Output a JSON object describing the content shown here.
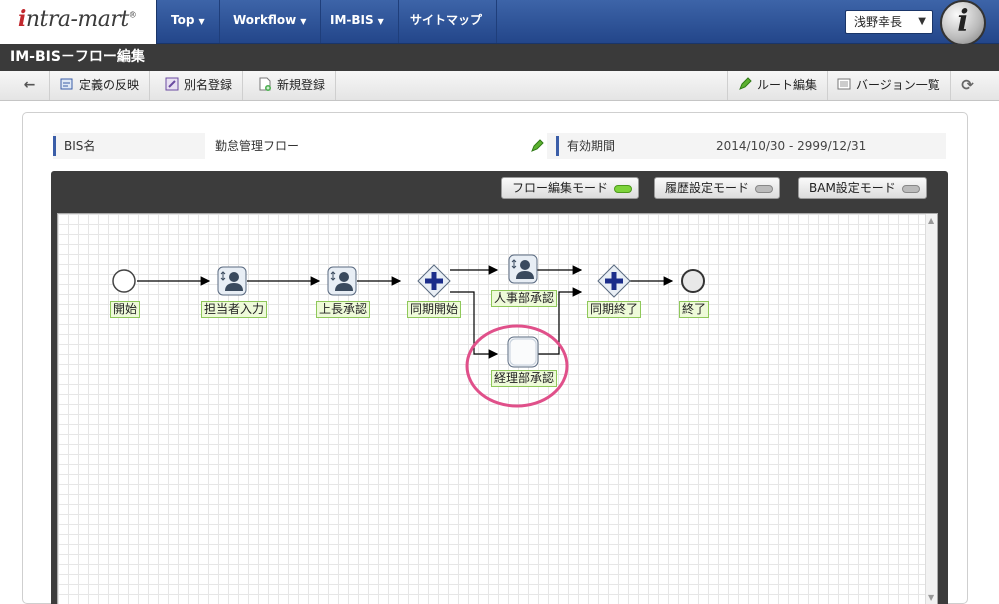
{
  "logo": {
    "text_i": "i",
    "text_rest": "ntra-mart",
    "reg": "®"
  },
  "nav": [
    {
      "label": "Top",
      "caret": "▼"
    },
    {
      "label": "Workflow",
      "caret": "▼"
    },
    {
      "label": "IM-BIS",
      "caret": "▼"
    },
    {
      "label": "サイトマップ",
      "caret": ""
    }
  ],
  "user": {
    "name": "浅野幸長",
    "caret": "▼",
    "avatar_letter": "i"
  },
  "page_title": "IM-BIS－フロー編集",
  "toolbar": {
    "back_icon": "←",
    "reflect": "定義の反映",
    "alias": "別名登録",
    "new": "新規登録",
    "route_edit": "ルート編集",
    "version_list": "バージョン一覧",
    "refresh_icon": "⟳"
  },
  "info": {
    "bis_name_label": "BIS名",
    "bis_name_value": "勤怠管理フロー",
    "period_label": "有効期間",
    "period_value": "2014/10/30 ‐ 2999/12/31"
  },
  "modes": [
    {
      "label": "フロー編集モード",
      "active": true
    },
    {
      "label": "履歴設定モード",
      "active": false
    },
    {
      "label": "BAM設定モード",
      "active": false
    }
  ],
  "flow": {
    "nodes": [
      {
        "id": "start",
        "label": "開始",
        "kind": "start"
      },
      {
        "id": "n1",
        "label": "担当者入力",
        "kind": "user-task"
      },
      {
        "id": "n2",
        "label": "上長承認",
        "kind": "user-task"
      },
      {
        "id": "g1",
        "label": "同期開始",
        "kind": "parallel-gateway"
      },
      {
        "id": "n3",
        "label": "人事部承認",
        "kind": "user-task"
      },
      {
        "id": "n4",
        "label": "経理部承認",
        "kind": "blank-task",
        "highlighted": true
      },
      {
        "id": "g2",
        "label": "同期終了",
        "kind": "parallel-gateway"
      },
      {
        "id": "end",
        "label": "終了",
        "kind": "end"
      }
    ]
  },
  "colors": {
    "nav": "#2f559c",
    "highlight": "#e0508a",
    "label_bg": "#eefad9"
  }
}
